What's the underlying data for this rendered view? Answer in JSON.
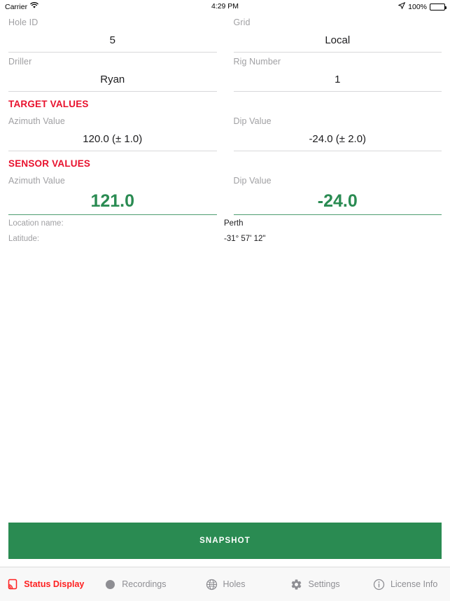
{
  "status_bar": {
    "carrier": "Carrier",
    "wifi_icon": "wifi-icon",
    "time": "4:29 PM",
    "location_icon": "location-arrow-icon",
    "battery_percent": "100%",
    "battery_icon": "battery-full-icon"
  },
  "form": {
    "fields": [
      {
        "label": "Hole ID",
        "value": "5"
      },
      {
        "label": "Grid",
        "value": "Local"
      },
      {
        "label": "Driller",
        "value": "Ryan"
      },
      {
        "label": "Rig Number",
        "value": "1"
      }
    ]
  },
  "target_section": {
    "header": "TARGET VALUES",
    "fields": [
      {
        "label": "Azimuth Value",
        "value": "120.0 (± 1.0)"
      },
      {
        "label": "Dip Value",
        "value": "-24.0 (± 2.0)"
      }
    ]
  },
  "sensor_section": {
    "header": "SENSOR VALUES",
    "fields": [
      {
        "label": "Azimuth Value",
        "value": "121.0"
      },
      {
        "label": "Dip Value",
        "value": "-24.0"
      }
    ]
  },
  "location_info": [
    {
      "key": "Location name:",
      "value": "Perth"
    },
    {
      "key": "Latitude:",
      "value": "-31° 57' 12\""
    }
  ],
  "snapshot_button": {
    "label": "SNAPSHOT"
  },
  "tab_bar": {
    "tabs": [
      {
        "label": "Status Display",
        "icon": "broadcast-screen-icon",
        "active": true
      },
      {
        "label": "Recordings",
        "icon": "record-dot-icon",
        "active": false
      },
      {
        "label": "Holes",
        "icon": "globe-icon",
        "active": false
      },
      {
        "label": "Settings",
        "icon": "gear-icon",
        "active": false
      },
      {
        "label": "License Info",
        "icon": "info-circle-icon",
        "active": false
      }
    ]
  },
  "colors": {
    "accent_red": "#e8112d",
    "tab_active_red": "#fe2020",
    "sensor_green": "#2a8b52",
    "label_gray": "#a0a0a3",
    "rule_gray": "#d8d8da"
  }
}
